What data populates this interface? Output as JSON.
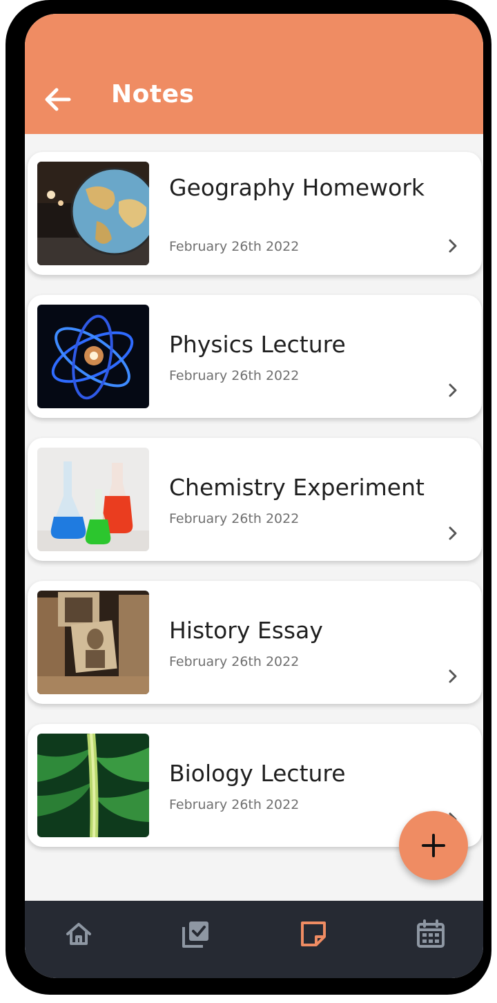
{
  "appbar": {
    "title": "Notes",
    "back_icon": "arrow-left-icon"
  },
  "colors": {
    "accent": "#ef8c63",
    "nav_bg": "#262a33",
    "nav_icon": "#8e97a3",
    "nav_active": "#ef8c63"
  },
  "notes": [
    {
      "title": "Geography Homework",
      "date": "February 26th 2022",
      "thumbnail": "globe-photo"
    },
    {
      "title": "Physics Lecture",
      "date": "February 26th 2022",
      "thumbnail": "atom-photo"
    },
    {
      "title": "Chemistry Experiment",
      "date": "February 26th 2022",
      "thumbnail": "flasks-photo"
    },
    {
      "title": "History Essay",
      "date": "February 26th 2022",
      "thumbnail": "old-photos-photo"
    },
    {
      "title": "Biology Lecture",
      "date": "February 26th 2022",
      "thumbnail": "leaf-photo"
    }
  ],
  "fab": {
    "icon": "plus-icon"
  },
  "bottom_nav": [
    {
      "icon": "home-icon",
      "active": false
    },
    {
      "icon": "tasks-icon",
      "active": false
    },
    {
      "icon": "note-icon",
      "active": true
    },
    {
      "icon": "calendar-icon",
      "active": false
    }
  ]
}
